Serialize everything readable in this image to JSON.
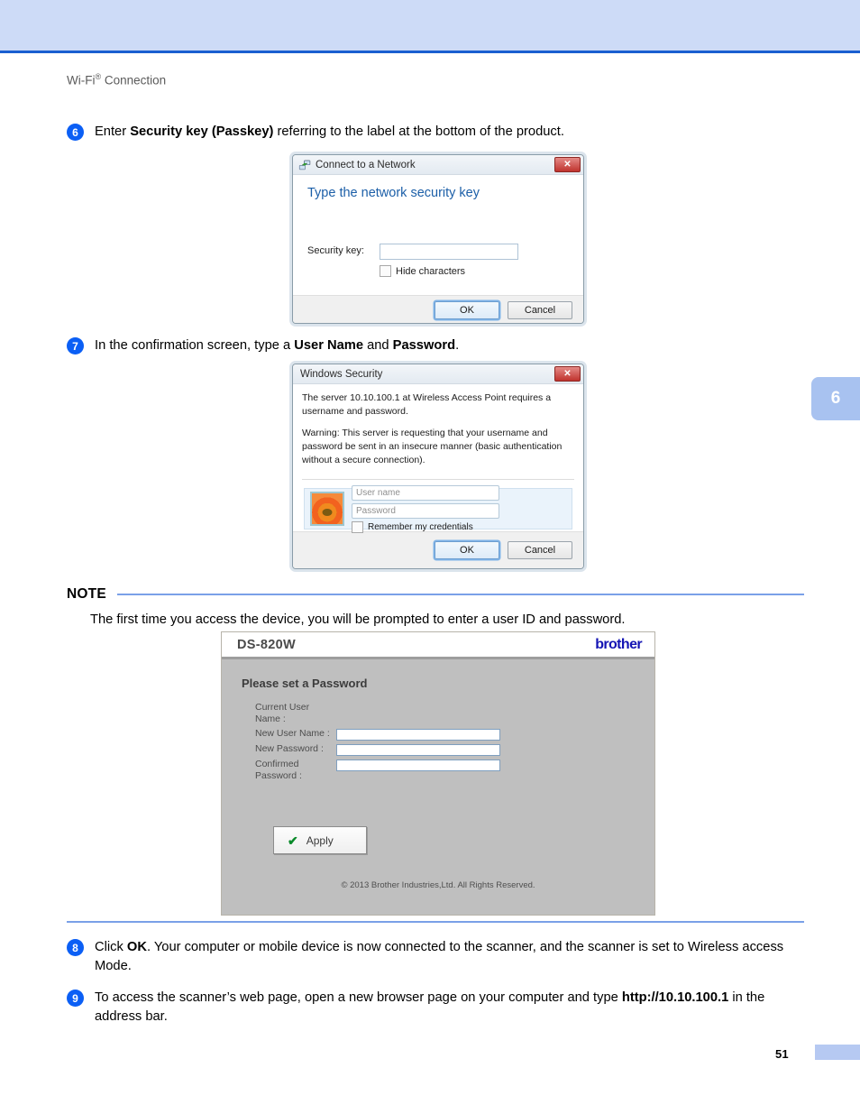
{
  "page": {
    "running_head_main": "Wi-Fi",
    "running_head_sup": "®",
    "running_head_tail": " Connection",
    "chapter_tab": "6",
    "page_number": "51",
    "accent_blue": "#0b5ff5",
    "banner_blue": "#cddbf7",
    "rule_blue": "#7aa0e8"
  },
  "steps": {
    "six": {
      "number": "6",
      "text_before": "Enter ",
      "bold": "Security key (Passkey)",
      "text_after": " referring to the label at the bottom of the product."
    },
    "seven": {
      "number": "7",
      "text_before": "In the confirmation screen, type a ",
      "bold1": "User Name",
      "text_middle": " and ",
      "bold2": "Password",
      "text_after": "."
    },
    "eight": {
      "number": "8",
      "text_before": "Click ",
      "bold": "OK",
      "text_after": ".  Your computer or mobile device is now connected to the scanner, and the scanner is set to Wireless access Mode."
    },
    "nine": {
      "number": "9",
      "text_before": "To access the scanner’s web page, open a new browser page on your computer and type ",
      "bold": "http://10.10.100.1",
      "text_after": " in the address bar."
    }
  },
  "note": {
    "label": "NOTE",
    "body": "The first time you access the device, you will be prompted to enter a user ID and password."
  },
  "connect_dialog": {
    "title": "Connect to a Network",
    "close_glyph": "✕",
    "heading": "Type the network security key",
    "security_key_label": "Security key:",
    "security_key_value": "",
    "hide_characters_label": "Hide characters",
    "hide_characters_checked": "false",
    "ok_label": "OK",
    "cancel_label": "Cancel"
  },
  "security_dialog": {
    "title": "Windows Security",
    "close_glyph": "✕",
    "paragraph1": "The server 10.10.100.1 at Wireless Access Point requires a username and password.",
    "paragraph2": "Warning: This server is requesting that your username and password be sent in an insecure manner (basic authentication without a secure connection).",
    "username_placeholder": "User name",
    "username_value": "",
    "password_placeholder": "Password",
    "password_value": "",
    "remember_label": "Remember my credentials",
    "remember_checked": "false",
    "ok_label": "OK",
    "cancel_label": "Cancel"
  },
  "web_page": {
    "model": "DS-820W",
    "brand": "brother",
    "title": "Please set a Password",
    "fields": [
      {
        "label": "Current User Name :",
        "value": "",
        "has_input": "false"
      },
      {
        "label": "New User Name :",
        "value": "",
        "has_input": "true"
      },
      {
        "label": "New Password :",
        "value": "",
        "has_input": "true"
      },
      {
        "label": "Confirmed Password :",
        "value": "",
        "has_input": "true"
      }
    ],
    "apply_label": "Apply",
    "apply_icon": "✔",
    "footer": "© 2013 Brother Industries,Ltd. All Rights Reserved."
  }
}
